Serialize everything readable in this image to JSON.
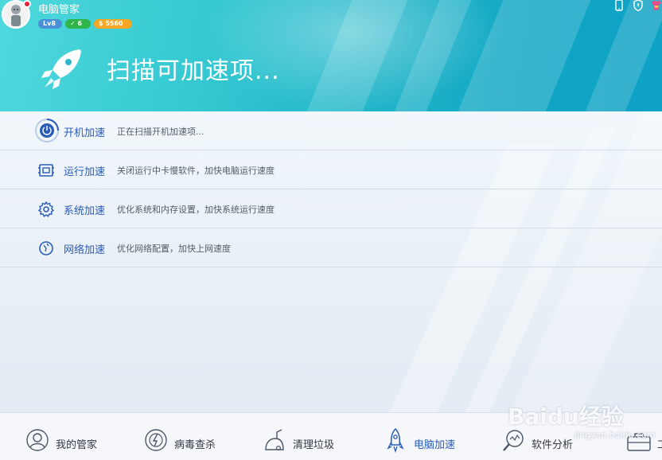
{
  "app": {
    "name": "电脑管家",
    "level": "Lv8",
    "shield_count": "6",
    "coins": "5560"
  },
  "header": {
    "status_title": "扫描可加速项..."
  },
  "items": [
    {
      "title": "开机加速",
      "desc": "正在扫描开机加速项...",
      "icon": "power-icon"
    },
    {
      "title": "运行加速",
      "desc": "关闭运行中卡慢软件，加快电脑运行速度",
      "icon": "memory-chip-icon"
    },
    {
      "title": "系统加速",
      "desc": "优化系统和内存设置，加快系统运行速度",
      "icon": "gear-icon"
    },
    {
      "title": "网络加速",
      "desc": "优化网络配置，加快上网速度",
      "icon": "globe-icon"
    }
  ],
  "nav": [
    {
      "label": "我的管家",
      "icon": "user-icon"
    },
    {
      "label": "病毒查杀",
      "icon": "virus-scan-icon"
    },
    {
      "label": "清理垃圾",
      "icon": "vacuum-icon"
    },
    {
      "label": "电脑加速",
      "icon": "rocket-icon",
      "active": true
    },
    {
      "label": "软件分析",
      "icon": "magnifier-icon"
    },
    {
      "label": "工",
      "icon": "toolbox-icon"
    }
  ],
  "watermark": {
    "text": "Baidu经验",
    "sub": "jingyan.baidu.com"
  },
  "colors": {
    "header_start": "#4fd8dc",
    "header_end": "#0ea1c6",
    "accent": "#2a5bb8"
  }
}
